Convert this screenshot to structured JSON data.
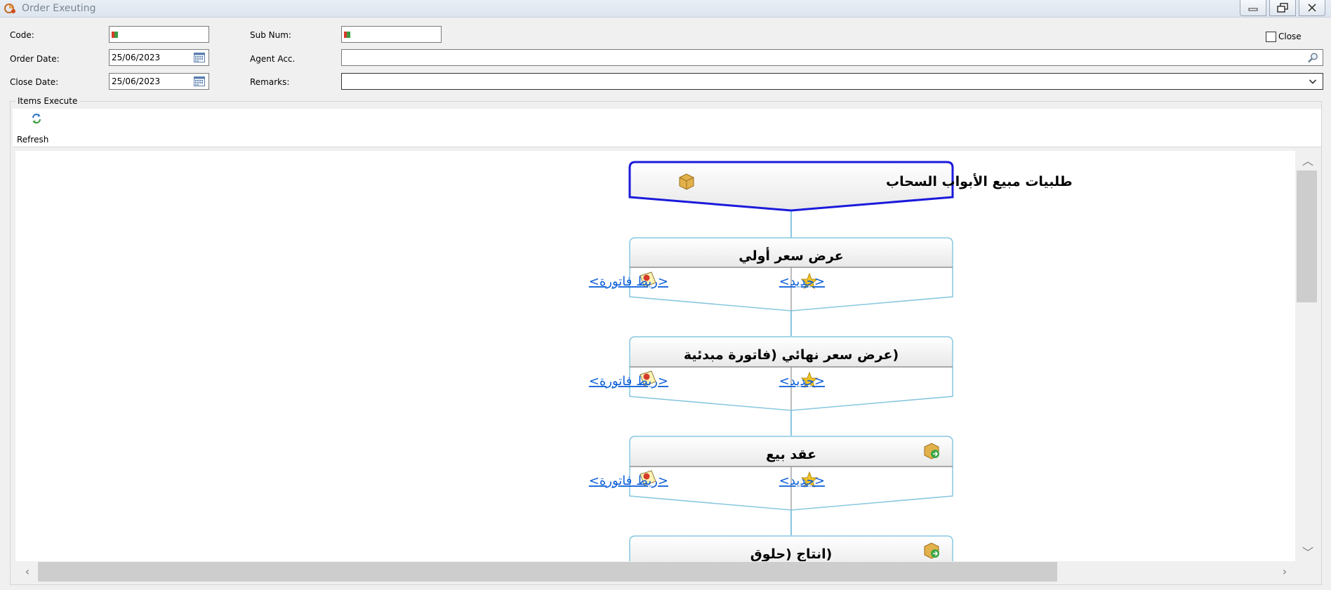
{
  "window": {
    "title": "Order Exeuting"
  },
  "form": {
    "code_label": "Code:",
    "code_value": "",
    "sub_num_label": "Sub Num:",
    "sub_num_value": "",
    "order_date_label": "Order Date:",
    "order_date_value": "25/06/2023",
    "agent_acc_label": "Agent Acc.",
    "agent_acc_value": "",
    "close_date_label": "Close Date:",
    "close_date_value": "25/06/2023",
    "remarks_label": "Remarks:",
    "remarks_value": "",
    "close_checkbox_label": "Close",
    "close_checked": false
  },
  "items_execute": {
    "group_title": "Items Execute",
    "refresh_label": "Refresh"
  },
  "flow": {
    "root_title": "طلبيات مبيع الأبواب السحاب",
    "stages": [
      {
        "title": "عرض سعر أولي",
        "link_invoice": "<ربط فاتورة>",
        "link_new": "<جديد>"
      },
      {
        "title": "(عرض سعر نهائي (فاتورة مبدئية",
        "link_invoice": "<ربط فاتورة>",
        "link_new": "<جديد>"
      },
      {
        "title": "عقد بيع",
        "link_invoice": "<ربط فاتورة>",
        "link_new": "<جديد>"
      },
      {
        "title": "(انتاج (حلوق"
      }
    ]
  },
  "colors": {
    "root_border": "#1a1adb",
    "stage_border": "#87c7e0",
    "link": "#0b5ed8"
  }
}
